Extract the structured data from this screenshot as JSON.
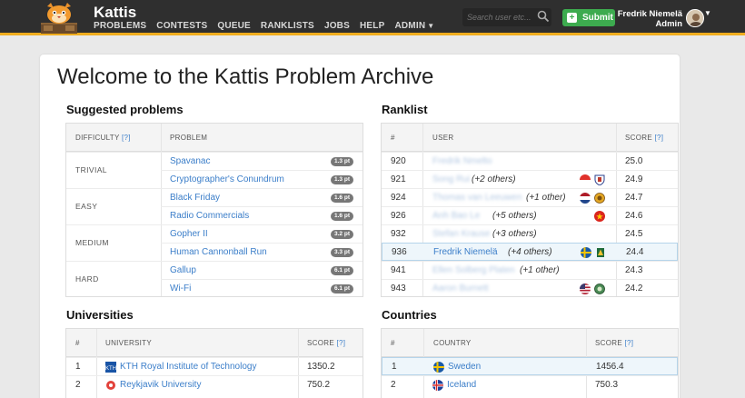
{
  "nav": {
    "brand": "Kattis",
    "menu": [
      "PROBLEMS",
      "CONTESTS",
      "QUEUE",
      "RANKLISTS",
      "JOBS",
      "HELP",
      "ADMIN"
    ],
    "search_placeholder": "Search user etc...",
    "submit_label": "Submit",
    "user_name": "Fredrik Niemelä",
    "user_role": "Admin"
  },
  "page": {
    "title": "Welcome to the Kattis Problem Archive"
  },
  "suggested": {
    "title": "Suggested problems",
    "col_difficulty": "DIFFICULTY",
    "col_q": "[?]",
    "col_problem": "PROBLEM",
    "groups": [
      {
        "label": "TRIVIAL",
        "problems": [
          {
            "name": "Spavanac",
            "points": "1.3 pt"
          },
          {
            "name": "Cryptographer's Conundrum",
            "points": "1.3 pt"
          }
        ]
      },
      {
        "label": "EASY",
        "problems": [
          {
            "name": "Black Friday",
            "points": "1.6 pt"
          },
          {
            "name": "Radio Commercials",
            "points": "1.6 pt"
          }
        ]
      },
      {
        "label": "MEDIUM",
        "problems": [
          {
            "name": "Gopher II",
            "points": "3.2 pt"
          },
          {
            "name": "Human Cannonball Run",
            "points": "3.3 pt"
          }
        ]
      },
      {
        "label": "HARD",
        "problems": [
          {
            "name": "Gallup",
            "points": "6.1 pt"
          },
          {
            "name": "Wi-Fi",
            "points": "6.1 pt"
          }
        ]
      }
    ]
  },
  "ranklist": {
    "title": "Ranklist",
    "col_rank": "#",
    "col_user": "USER",
    "col_score": "SCORE",
    "col_q": "[?]",
    "rows": [
      {
        "rank": "920",
        "user": "Fredrik Nmelto",
        "others": "",
        "score": "25.0"
      },
      {
        "rank": "921",
        "user": "Song Rui",
        "others": "(+2 others)",
        "score": "24.9"
      },
      {
        "rank": "924",
        "user": "Thomas van Leeuwen",
        "others": "(+1 other)",
        "score": "24.7"
      },
      {
        "rank": "926",
        "user": "Anh Bao Le",
        "others": "(+5 others)",
        "score": "24.6"
      },
      {
        "rank": "932",
        "user": "Stefan Krause",
        "others": "(+3 others)",
        "score": "24.5"
      },
      {
        "rank": "936",
        "user": "Fredrik Niemelä",
        "others": "(+4 others)",
        "score": "24.4"
      },
      {
        "rank": "941",
        "user": "Ellen Solberg Platen",
        "others": "(+1 other)",
        "score": "24.3"
      },
      {
        "rank": "943",
        "user": "Aaron Burnett",
        "others": "",
        "score": "24.2"
      }
    ]
  },
  "universities": {
    "title": "Universities",
    "col_rank": "#",
    "col_name": "UNIVERSITY",
    "col_score": "SCORE",
    "col_q": "[?]",
    "rows": [
      {
        "rank": "1",
        "name": "KTH Royal Institute of Technology",
        "score": "1350.2"
      },
      {
        "rank": "2",
        "name": "Reykjavik University",
        "score": "750.2"
      }
    ]
  },
  "countries": {
    "title": "Countries",
    "col_rank": "#",
    "col_name": "COUNTRY",
    "col_score": "SCORE",
    "col_q": "[?]",
    "rows": [
      {
        "rank": "1",
        "name": "Sweden",
        "score": "1456.4"
      },
      {
        "rank": "2",
        "name": "Iceland",
        "score": "750.3"
      }
    ]
  },
  "colors": {
    "accent": "#f0ad1e",
    "link": "#3b7ec9",
    "submit": "#3dab4f",
    "nav_bg": "#2f2f2f"
  }
}
